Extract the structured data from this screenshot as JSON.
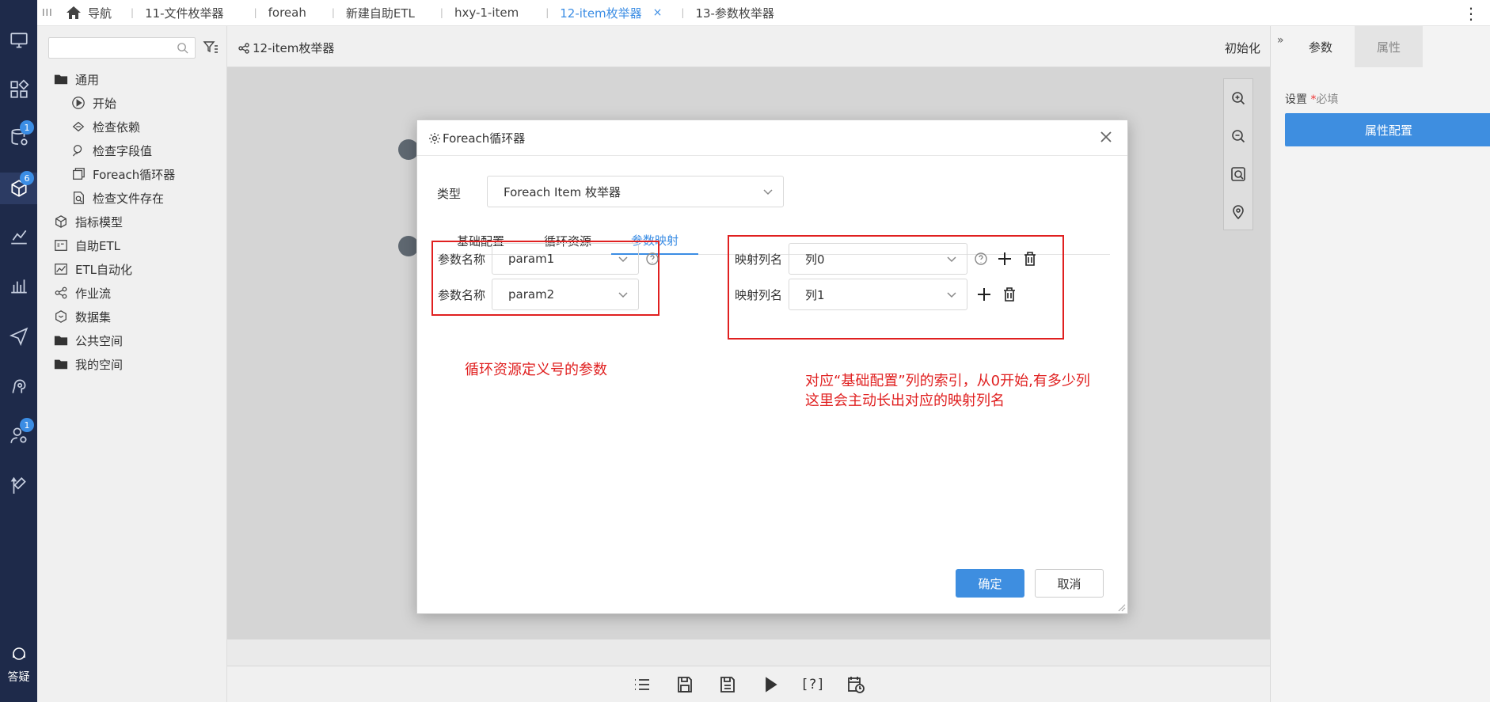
{
  "colors": {
    "accent": "#3b8de4",
    "rail_bg": "#1e2a4a",
    "annotation": "#e02020",
    "primary_button": "#3e8ee0"
  },
  "rail": {
    "items": [
      {
        "icon": "monitor-icon"
      },
      {
        "icon": "widgets-icon"
      },
      {
        "icon": "database-gear-icon",
        "badge": "1"
      },
      {
        "icon": "cube-icon",
        "badge": "6"
      },
      {
        "icon": "chart-bars-icon"
      },
      {
        "icon": "send-icon"
      },
      {
        "icon": "brain-gear-icon"
      },
      {
        "icon": "user-gear-icon",
        "badge": "1"
      },
      {
        "icon": "tools-icon"
      }
    ],
    "help_label": "答疑"
  },
  "tabbar": {
    "grip": "III",
    "tabs": [
      {
        "label": "导航",
        "icon": "home-icon"
      },
      {
        "label": "11-文件枚举器"
      },
      {
        "label": "foreah"
      },
      {
        "label": "新建自助ETL"
      },
      {
        "label": "hxy-1-item"
      },
      {
        "label": "12-item枚举器",
        "active": true,
        "close": "×"
      },
      {
        "label": "13-参数枚举器"
      }
    ],
    "more": "⋮"
  },
  "tree": {
    "search_placeholder": "",
    "items": [
      {
        "label": "通用",
        "level": 1,
        "icon": "folder-icon"
      },
      {
        "label": "开始",
        "level": 2,
        "icon": "play-circle-icon"
      },
      {
        "label": "检查依赖",
        "level": 2,
        "icon": "dependency-icon"
      },
      {
        "label": "检查字段值",
        "level": 2,
        "icon": "field-check-icon"
      },
      {
        "label": "Foreach循环器",
        "level": 2,
        "icon": "loop-icon"
      },
      {
        "label": "检查文件存在",
        "level": 2,
        "icon": "file-search-icon"
      },
      {
        "label": "指标模型",
        "level": 1,
        "icon": "cube-icon"
      },
      {
        "label": "自助ETL",
        "level": 1,
        "icon": "etl-icon"
      },
      {
        "label": "ETL自动化",
        "level": 1,
        "icon": "etl-auto-icon"
      },
      {
        "label": "作业流",
        "level": 1,
        "icon": "workflow-icon"
      },
      {
        "label": "数据集",
        "level": 1,
        "icon": "dataset-icon"
      },
      {
        "label": "公共空间",
        "level": 1,
        "icon": "folder-icon"
      },
      {
        "label": "我的空间",
        "level": 1,
        "icon": "folder-icon"
      }
    ]
  },
  "workspace": {
    "title": "12-item枚举器",
    "init_label": "初始化",
    "footer_help": "[?]"
  },
  "right_panel": {
    "tabs": [
      "参数",
      "属性"
    ],
    "settings_label": "设置",
    "required_mark": "*",
    "required_text": "必填",
    "config_button": "属性配置"
  },
  "modal": {
    "title": "Foreach循环器",
    "type_label": "类型",
    "type_value": "Foreach Item 枚举器",
    "tabs": [
      "基础配置",
      "循环资源",
      "参数映射"
    ],
    "active_tab": 2,
    "params": [
      {
        "label": "参数名称",
        "value": "param1"
      },
      {
        "label": "参数名称",
        "value": "param2"
      }
    ],
    "mappings": [
      {
        "label": "映射列名",
        "value": "列0"
      },
      {
        "label": "映射列名",
        "value": "列1"
      }
    ],
    "note_left": "循环资源定义号的参数",
    "note_right_line1": "对应“基础配置”列的索引，从0开始,有多少列",
    "note_right_line2": "这里会主动长出对应的映射列名",
    "ok_label": "确定",
    "cancel_label": "取消"
  }
}
